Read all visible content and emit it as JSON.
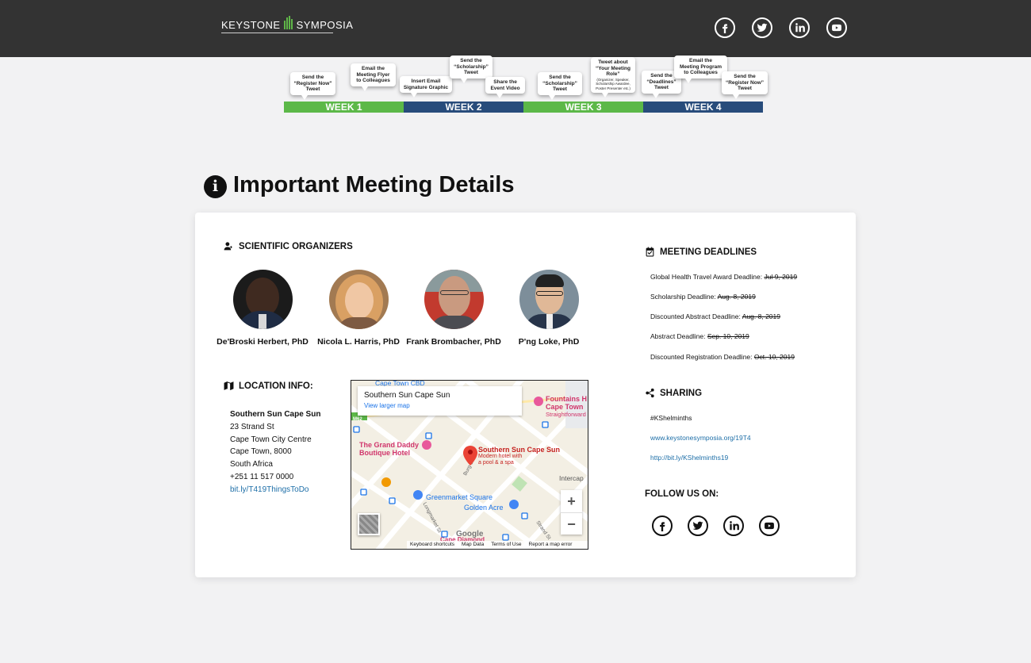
{
  "header": {
    "logo_left": "KEYSTONE",
    "logo_right": "SYMPOSIA",
    "social_icons": [
      "facebook-icon",
      "twitter-icon",
      "linkedin-icon",
      "youtube-icon"
    ]
  },
  "timeline": {
    "weeks": [
      "WEEK 1",
      "WEEK 2",
      "WEEK 3",
      "WEEK 4"
    ],
    "bubbles": [
      {
        "lines": [
          "Send the",
          "“Register Now”",
          "Tweet"
        ]
      },
      {
        "lines": [
          "Email the",
          "Meeting Flyer",
          "to Colleagues"
        ]
      },
      {
        "lines": [
          "Insert Email",
          "Signature Graphic"
        ]
      },
      {
        "lines": [
          "Send the",
          "“Scholarship”",
          "Tweet"
        ]
      },
      {
        "lines": [
          "Share the",
          "Event Video"
        ]
      },
      {
        "lines": [
          "Send the",
          "“Scholarship”",
          "Tweet"
        ]
      },
      {
        "lines": [
          "Tweet about",
          "“Your Meeting",
          "Role”"
        ],
        "small": "(Organizer, Speaker, Scholarship Awardee, Poster Presenter etc.)"
      },
      {
        "lines": [
          "Send the",
          "“Deadlines”",
          "Tweet"
        ]
      },
      {
        "lines": [
          "Email the",
          "Meeting Program",
          "to Colleagues"
        ]
      },
      {
        "lines": [
          "Send the",
          "“Register Now”",
          "Tweet"
        ]
      }
    ]
  },
  "page": {
    "title": "Important Meeting Details"
  },
  "organizers": {
    "title": "SCIENTIFIC ORGANIZERS",
    "people": [
      {
        "name": "De'Broski Herbert, PhD"
      },
      {
        "name": "Nicola L. Harris, PhD"
      },
      {
        "name": "Frank Brombacher, PhD"
      },
      {
        "name": "P'ng Loke, PhD"
      }
    ]
  },
  "location": {
    "title": "LOCATION INFO:",
    "venue": "Southern Sun Cape Sun",
    "street": "23 Strand St",
    "area": "Cape Town City Centre",
    "city": "Cape Town, 8000",
    "country": "South Africa",
    "phone": "+251 11 517 0000",
    "link": "bit.ly/T419ThingsToDo"
  },
  "map": {
    "card_title": "Southern Sun Cape Sun",
    "card_link": "View larger map",
    "labels": {
      "cbd": "Cape Town CBD",
      "fountains": "Fountains H\nCape Town",
      "fountains_sub": "Straightforward",
      "grand_daddy": "The Grand Daddy\nBoutique Hotel",
      "sun": "Southern Sun Cape Sun",
      "sun_sub": "Modern hotel with\na pool & a spa",
      "greenmarket": "Greenmarket Square",
      "golden": "Golden Acre",
      "intercap": "Intercap",
      "burg": "Burg St",
      "long": "Longmarket St",
      "strand": "Strand St",
      "diamond": "Cape Diamond",
      "m62": "M62"
    },
    "zoom_in": "+",
    "zoom_out": "−",
    "google": "Google",
    "footer": [
      "Keyboard shortcuts",
      "Map Data",
      "Terms of Use",
      "Report a map error"
    ]
  },
  "deadlines": {
    "title": "MEETING DEADLINES",
    "items": [
      {
        "label": "Global Health Travel Award Deadline:",
        "date": "Jul 9, 2019"
      },
      {
        "label": "Scholarship Deadline:",
        "date": "Aug. 8, 2019"
      },
      {
        "label": "Discounted Abstract Deadline:",
        "date": "Aug. 8, 2019"
      },
      {
        "label": "Abstract Deadline:",
        "date": "Sep. 10, 2019"
      },
      {
        "label": "Discounted Registration Deadline:",
        "date": "Oct. 10, 2019"
      }
    ]
  },
  "sharing": {
    "title": "SHARING",
    "hashtag": "#KShelminths",
    "link1": "www.keystonesymposia.org/19T4",
    "link2": "http://bit.ly/KShelminths19"
  },
  "follow": {
    "title": "FOLLOW US ON:"
  },
  "colors": {
    "header_bg": "#333333",
    "week_green": "#5cb848",
    "week_blue": "#284c7b",
    "link": "#1e6fa8"
  }
}
